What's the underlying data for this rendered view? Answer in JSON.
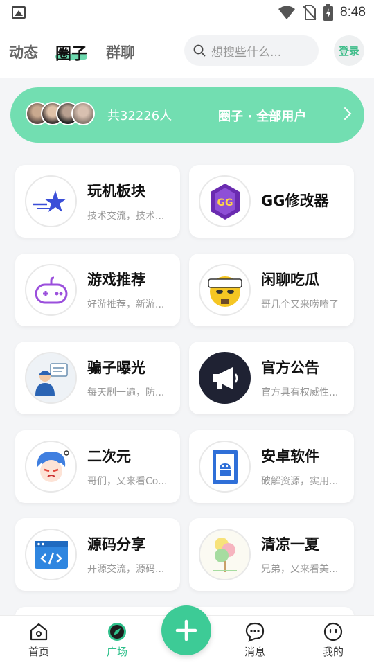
{
  "status_bar": {
    "time": "8:48"
  },
  "header": {
    "tabs": [
      {
        "label": "动态",
        "active": false
      },
      {
        "label": "圈子",
        "active": true
      },
      {
        "label": "群聊",
        "active": false
      }
    ],
    "search_placeholder": "想搜些什么...",
    "login_label": "登录"
  },
  "banner": {
    "member_count": "共32226人",
    "title": "圈子 · 全部用户"
  },
  "cards": [
    {
      "title": "玩机板块",
      "subtitle": "技术交流，技术...",
      "icon": "star-icon"
    },
    {
      "title": "GG修改器",
      "subtitle": "",
      "icon": "gg-icon"
    },
    {
      "title": "游戏推荐",
      "subtitle": "好游推荐，新游...",
      "icon": "gamepad-icon"
    },
    {
      "title": "闲聊吃瓜",
      "subtitle": "哥几个又来唠嗑了",
      "icon": "emoji-face-icon"
    },
    {
      "title": "骗子曝光",
      "subtitle": "每天刷一遍，防...",
      "icon": "support-agent-icon"
    },
    {
      "title": "官方公告",
      "subtitle": "官方具有权威性...",
      "icon": "megaphone-icon"
    },
    {
      "title": "二次元",
      "subtitle": "哥们，又来看Co...",
      "icon": "anime-character-icon"
    },
    {
      "title": "安卓软件",
      "subtitle": "破解资源，实用...",
      "icon": "android-icon"
    },
    {
      "title": "源码分享",
      "subtitle": "开源交流，源码...",
      "icon": "code-window-icon"
    },
    {
      "title": "清凉一夏",
      "subtitle": "兄弟，又来看美...",
      "icon": "ice-cream-icon"
    }
  ],
  "bottom_nav": [
    {
      "label": "首页",
      "icon": "home-icon",
      "active": false
    },
    {
      "label": "广场",
      "icon": "compass-icon",
      "active": true
    },
    {
      "label": "消息",
      "icon": "message-icon",
      "active": false
    },
    {
      "label": "我的",
      "icon": "profile-icon",
      "active": false
    }
  ],
  "colors": {
    "accent": "#3dcb96",
    "banner": "#72deb1",
    "active_tab_underline": "#6cd9ae"
  }
}
